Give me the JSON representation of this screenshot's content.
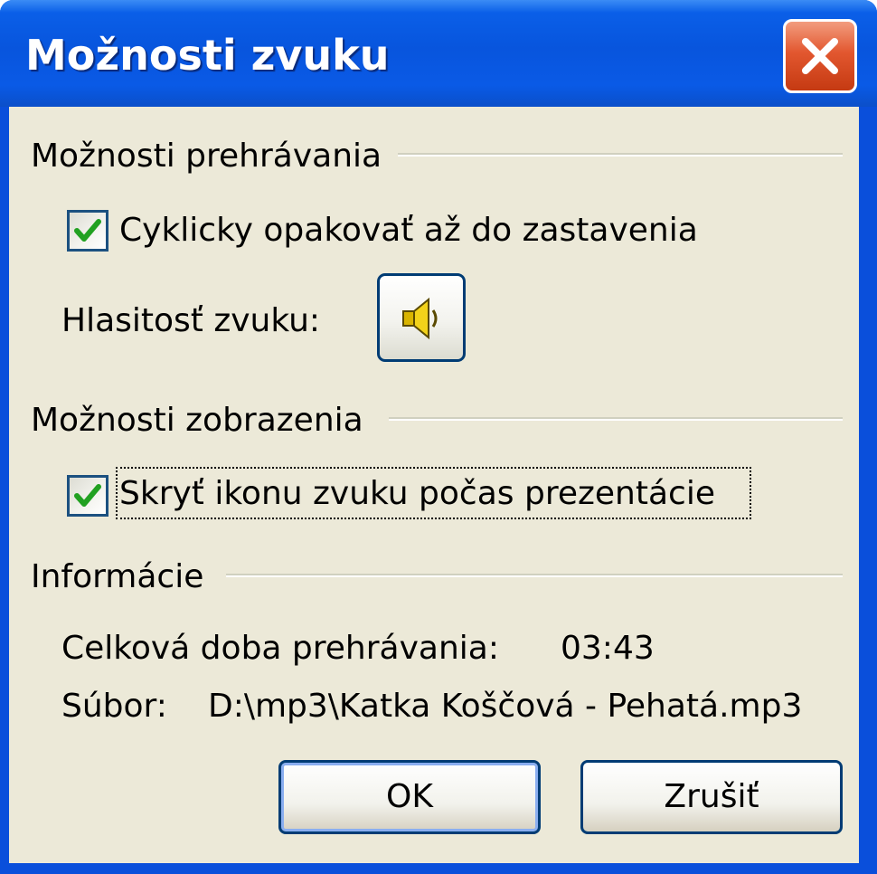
{
  "window": {
    "title": "Možnosti zvuku",
    "close_icon": "close-x-icon"
  },
  "playback": {
    "section_title": "Možnosti prehrávania",
    "loop_label": "Cyklicky opakovať až do zastavenia",
    "loop_checked": true,
    "volume_label": "Hlasitosť zvuku:",
    "volume_icon": "speaker-icon"
  },
  "display": {
    "section_title": "Možnosti zobrazenia",
    "hide_icon_label": "Skryť ikonu zvuku počas prezentácie",
    "hide_icon_checked": true
  },
  "info": {
    "section_title": "Informácie",
    "duration_label": "Celková doba prehrávania:",
    "duration_value": "03:43",
    "file_label": "Súbor:",
    "file_value": "D:\\mp3\\Katka Koščová - Pehatá.mp3"
  },
  "buttons": {
    "ok_label": "OK",
    "cancel_label": "Zrušiť"
  },
  "colors": {
    "title_bar": "#0855dd",
    "dialog_bg": "#ece9d8",
    "check_mark": "#21a121",
    "close_button": "#e2572f"
  }
}
